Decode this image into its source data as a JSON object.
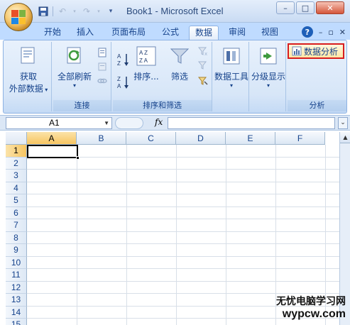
{
  "window": {
    "title": "Book1 - Microsoft Excel"
  },
  "quick_access": {
    "save_icon": "save-icon",
    "undo_icon": "undo-icon",
    "redo_icon": "redo-icon",
    "customize_icon": "customize-icon"
  },
  "window_buttons": {
    "minimize": "–",
    "maximize": "□",
    "close": "✕"
  },
  "tabs": [
    {
      "label": "开始"
    },
    {
      "label": "插入"
    },
    {
      "label": "页面布局"
    },
    {
      "label": "公式"
    },
    {
      "label": "数据"
    },
    {
      "label": "审阅"
    },
    {
      "label": "视图"
    }
  ],
  "active_tab": "数据",
  "ribbon_controls": {
    "help": "?",
    "minimize": "–",
    "restore": "▫",
    "close": "✕"
  },
  "ribbon": {
    "get_external": {
      "line1": "获取",
      "line2": "外部数据"
    },
    "connections": {
      "refresh_all": "全部刷新",
      "group_label": "连接"
    },
    "sort_filter": {
      "sort": "排序...",
      "filter": "筛选",
      "group_label": "排序和筛选",
      "sort_az": "A Z",
      "sort_za": "Z A"
    },
    "data_tools": {
      "label": "数据工具"
    },
    "outline": {
      "label": "分级显示"
    },
    "analysis": {
      "data_analysis": "数据分析",
      "group_label": "分析"
    }
  },
  "formula_bar": {
    "name_box": "A1",
    "fx": "fx",
    "formula": ""
  },
  "sheet": {
    "columns": [
      "A",
      "B",
      "C",
      "D",
      "E",
      "F"
    ],
    "rows": [
      "1",
      "2",
      "3",
      "4",
      "5",
      "6",
      "7",
      "8",
      "9",
      "10",
      "11",
      "12",
      "13",
      "14",
      "15"
    ],
    "active_cell": "A1"
  },
  "watermark": {
    "line1": "无忧电脑学习网",
    "line2": "wypcw.com"
  },
  "colors": {
    "accent": "#15428b",
    "highlight_border": "#d81e1e",
    "active_header": "#f7c561"
  }
}
